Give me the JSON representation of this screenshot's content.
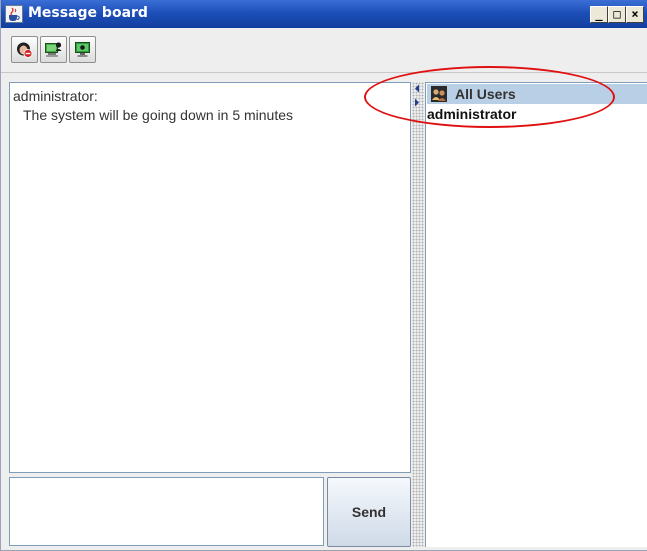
{
  "window": {
    "title": "Message board",
    "controls": {
      "minimize": "_",
      "maximize": "□",
      "close": "×"
    }
  },
  "toolbar": {
    "buttons": [
      {
        "icon": "user-block-icon"
      },
      {
        "icon": "computer-user-icon"
      },
      {
        "icon": "monitor-view-icon"
      }
    ]
  },
  "messages": [
    {
      "sender": "administrator:",
      "text": "The system will be going down in 5 minutes"
    }
  ],
  "compose": {
    "value": "",
    "send_label": "Send"
  },
  "users": {
    "header": "All Users",
    "list": [
      "administrator"
    ]
  },
  "colors": {
    "titlebar": "#1d4fb8",
    "users_header": "#b8cfe5",
    "highlight": "#e01010"
  }
}
